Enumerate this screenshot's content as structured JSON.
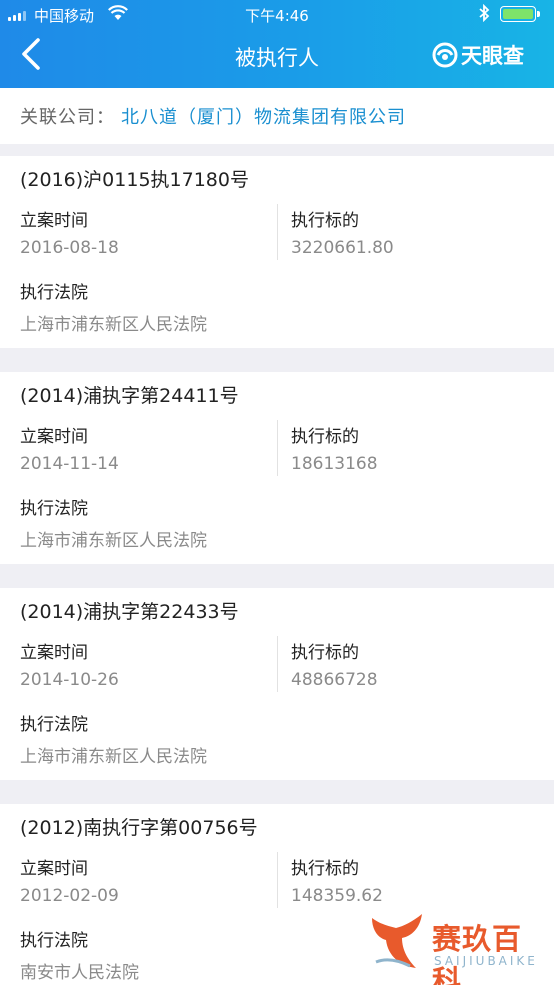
{
  "status_bar": {
    "carrier": "中国移动",
    "time": "下午4:46"
  },
  "nav": {
    "title": "被执行人",
    "brand": "天眼查"
  },
  "related": {
    "label": "关联公司：",
    "company": "北八道（厦门）物流集团有限公司"
  },
  "labels": {
    "filing_date": "立案时间",
    "target": "执行标的",
    "court": "执行法院"
  },
  "cases": [
    {
      "case_no": "(2016)沪0115执17180号",
      "filing_date": "2016-08-18",
      "target": "3220661.80",
      "court": "上海市浦东新区人民法院"
    },
    {
      "case_no": "(2014)浦执字第24411号",
      "filing_date": "2014-11-14",
      "target": "18613168",
      "court": "上海市浦东新区人民法院"
    },
    {
      "case_no": "(2014)浦执字第22433号",
      "filing_date": "2014-10-26",
      "target": "48866728",
      "court": "上海市浦东新区人民法院"
    },
    {
      "case_no": "(2012)南执行字第00756号",
      "filing_date": "2012-02-09",
      "target": "148359.62",
      "court": "南安市人民法院"
    }
  ],
  "watermark": {
    "text": "赛玖百科",
    "sub": "SAIJIUBAIKE"
  },
  "colors": {
    "header_start": "#1f8ae8",
    "header_end": "#18b4e6",
    "company_link": "#1a8fd0",
    "watermark": "#e85a2c"
  }
}
